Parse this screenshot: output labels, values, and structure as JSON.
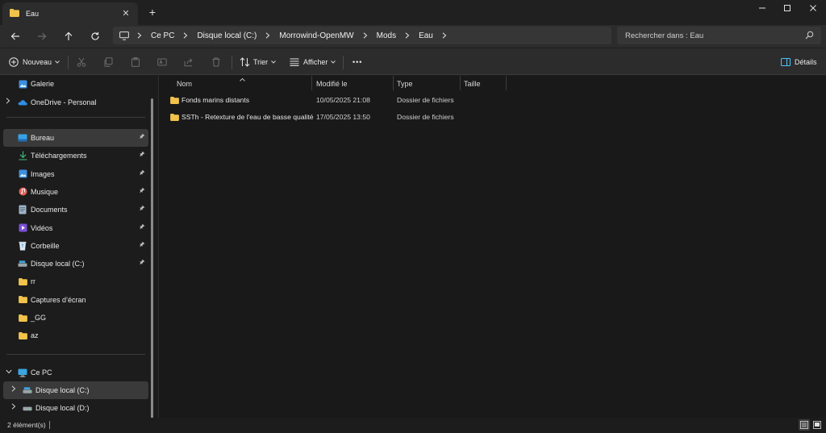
{
  "tab": {
    "title": "Eau",
    "close": "✕",
    "new": "+"
  },
  "window_controls": {
    "minimize": "—",
    "maximize": "☐",
    "close": "✕"
  },
  "breadcrumb": [
    "Ce PC",
    "Disque local (C:)",
    "Morrowind-OpenMW",
    "Mods",
    "Eau"
  ],
  "search": {
    "placeholder": "Rechercher dans : Eau"
  },
  "toolbar": {
    "new_label": "Nouveau",
    "sort_label": "Trier",
    "view_label": "Afficher",
    "more_label": "•••",
    "details_label": "Détails"
  },
  "sidebar": {
    "top": [
      {
        "label": "Galerie",
        "icon": "gallery-icon"
      },
      {
        "label": "OneDrive - Personal",
        "icon": "onedrive-icon"
      }
    ],
    "quick_access": [
      {
        "label": "Bureau",
        "icon": "desktop-icon",
        "pinned": true,
        "selected": true
      },
      {
        "label": "Téléchargements",
        "icon": "download-icon",
        "pinned": true
      },
      {
        "label": "Images",
        "icon": "images-icon",
        "pinned": true
      },
      {
        "label": "Musique",
        "icon": "music-icon",
        "pinned": true
      },
      {
        "label": "Documents",
        "icon": "documents-icon",
        "pinned": true
      },
      {
        "label": "Vidéos",
        "icon": "videos-icon",
        "pinned": true
      },
      {
        "label": "Corbeille",
        "icon": "recycle-bin-icon",
        "pinned": true
      },
      {
        "label": "Disque local (C:)",
        "icon": "drive-icon",
        "pinned": true
      },
      {
        "label": "rr",
        "icon": "folder-icon"
      },
      {
        "label": "Captures d’écran",
        "icon": "folder-icon"
      },
      {
        "label": "_GG",
        "icon": "folder-icon"
      },
      {
        "label": "az",
        "icon": "folder-icon"
      }
    ],
    "this_pc": {
      "label": "Ce PC",
      "children": [
        {
          "label": "Disque local (C:)"
        },
        {
          "label": "Disque local (D:)"
        }
      ]
    }
  },
  "columns": {
    "name": "Nom",
    "modified": "Modifié le",
    "type": "Type",
    "size": "Taille"
  },
  "files": [
    {
      "name": "Fonds marins distants",
      "modified": "10/05/2025 21:08",
      "type": "Dossier de fichiers",
      "size": ""
    },
    {
      "name": "SSTh - Retexture de l'eau de basse qualité",
      "modified": "17/05/2025 13:50",
      "type": "Dossier de fichiers",
      "size": ""
    }
  ],
  "status": {
    "count": "2 élément(s)"
  },
  "colors": {
    "folder": "#f2c34b",
    "accent": "#4cc2ff",
    "selected_bg": "#3a3a3a"
  }
}
